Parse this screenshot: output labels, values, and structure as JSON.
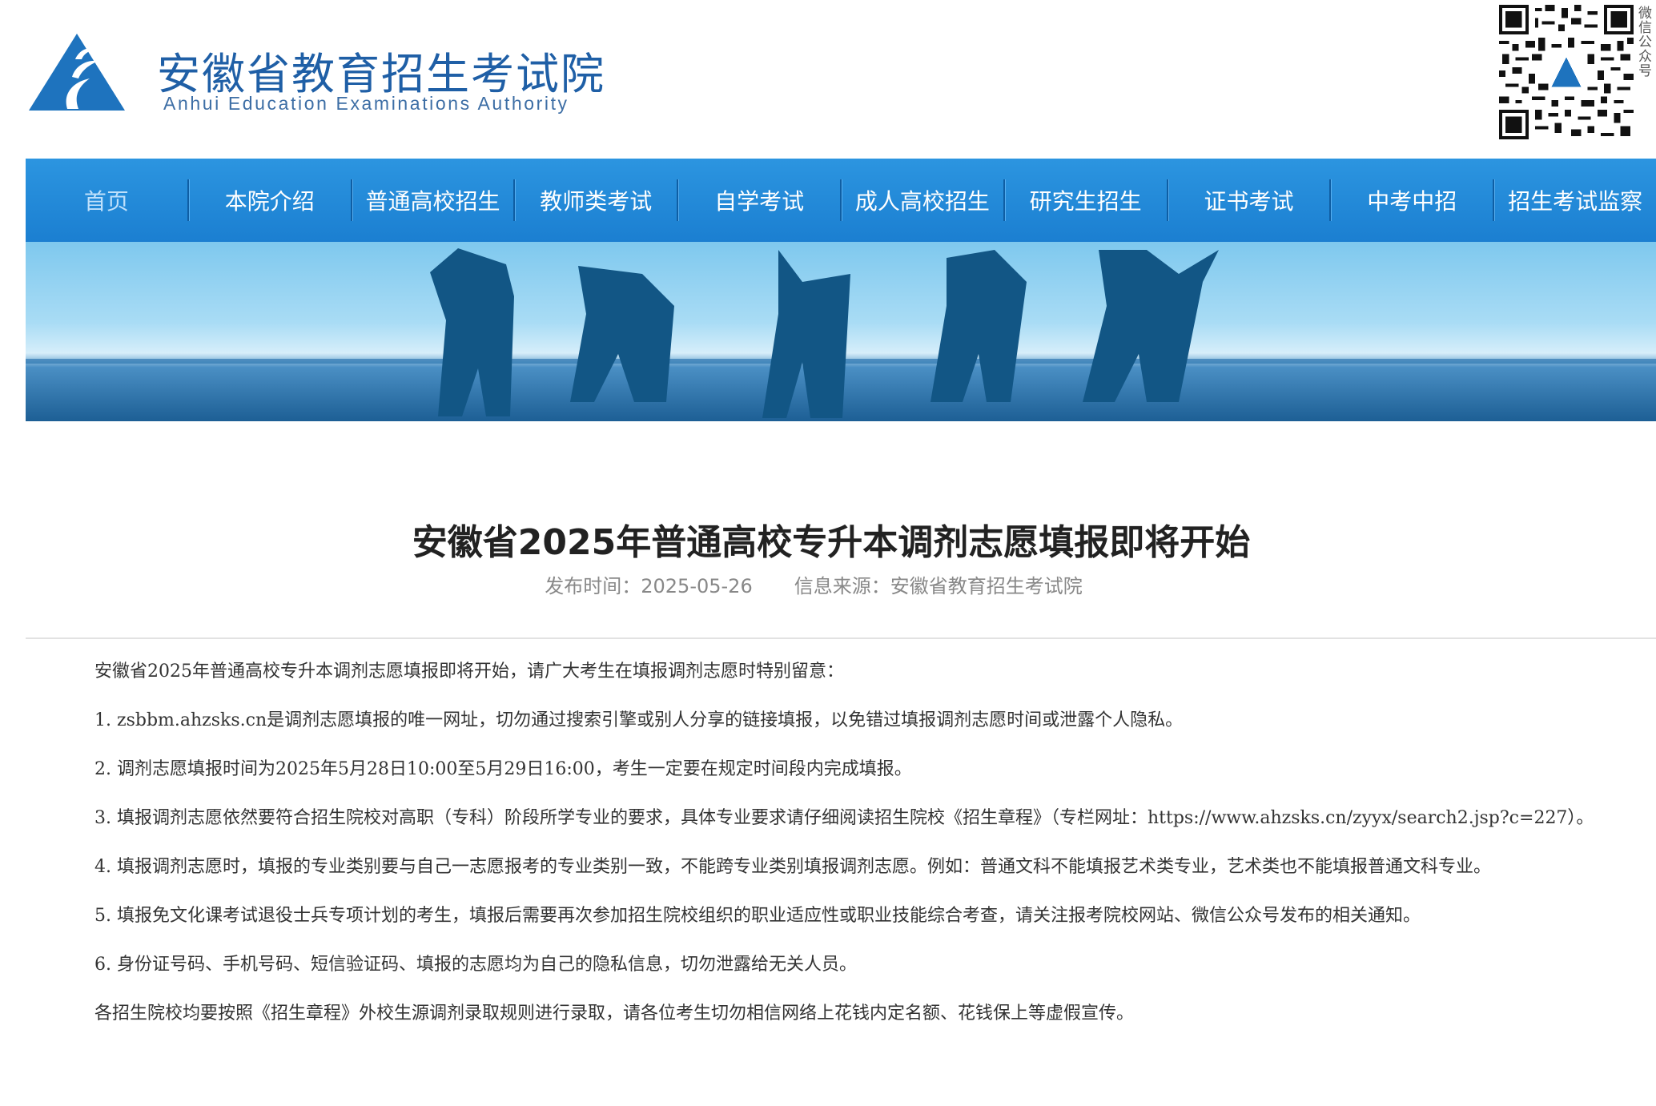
{
  "header": {
    "org_name_cn": "安徽省教育招生考试院",
    "org_name_en": "Anhui Education Examinations Authority",
    "qr_caption": "微信公众号"
  },
  "nav": {
    "items": [
      {
        "label": "首页",
        "active": true
      },
      {
        "label": "本院介绍"
      },
      {
        "label": "普通高校招生"
      },
      {
        "label": "教师类考试"
      },
      {
        "label": "自学考试"
      },
      {
        "label": "成人高校招生"
      },
      {
        "label": "研究生招生"
      },
      {
        "label": "证书考试"
      },
      {
        "label": "中考中招"
      },
      {
        "label": "招生考试监察"
      }
    ]
  },
  "article": {
    "title": "安徽省2025年普通高校专升本调剂志愿填报即将开始",
    "publish_time": "发布时间：2025-05-26",
    "source": "信息来源：安徽省教育招生考试院",
    "paragraphs": [
      "安徽省2025年普通高校专升本调剂志愿填报即将开始，请广大考生在填报调剂志愿时特别留意：",
      "1. zsbbm.ahzsks.cn是调剂志愿填报的唯一网址，切勿通过搜索引擎或别人分享的链接填报，以免错过填报调剂志愿时间或泄露个人隐私。",
      "2. 调剂志愿填报时间为2025年5月28日10:00至5月29日16:00，考生一定要在规定时间段内完成填报。",
      "3. 填报调剂志愿依然要符合招生院校对高职（专科）阶段所学专业的要求，具体专业要求请仔细阅读招生院校《招生章程》（专栏网址：https://www.ahzsks.cn/zyyx/search2.jsp?c=227）。",
      "4. 填报调剂志愿时，填报的专业类别要与自己一志愿报考的专业类别一致，不能跨专业类别填报调剂志愿。例如：普通文科不能填报艺术类专业，艺术类也不能填报普通文科专业。",
      "5. 填报免文化课考试退役士兵专项计划的考生，填报后需要再次参加招生院校组织的职业适应性或职业技能综合考查，请关注报考院校网站、微信公众号发布的相关通知。",
      "6. 身份证号码、手机号码、短信验证码、填报的志愿均为自己的隐私信息，切勿泄露给无关人员。",
      "各招生院校均要按照《招生章程》外校生源调剂录取规则进行录取，请各位考生切勿相信网络上花钱内定名额、花钱保上等虚假宣传。"
    ]
  }
}
